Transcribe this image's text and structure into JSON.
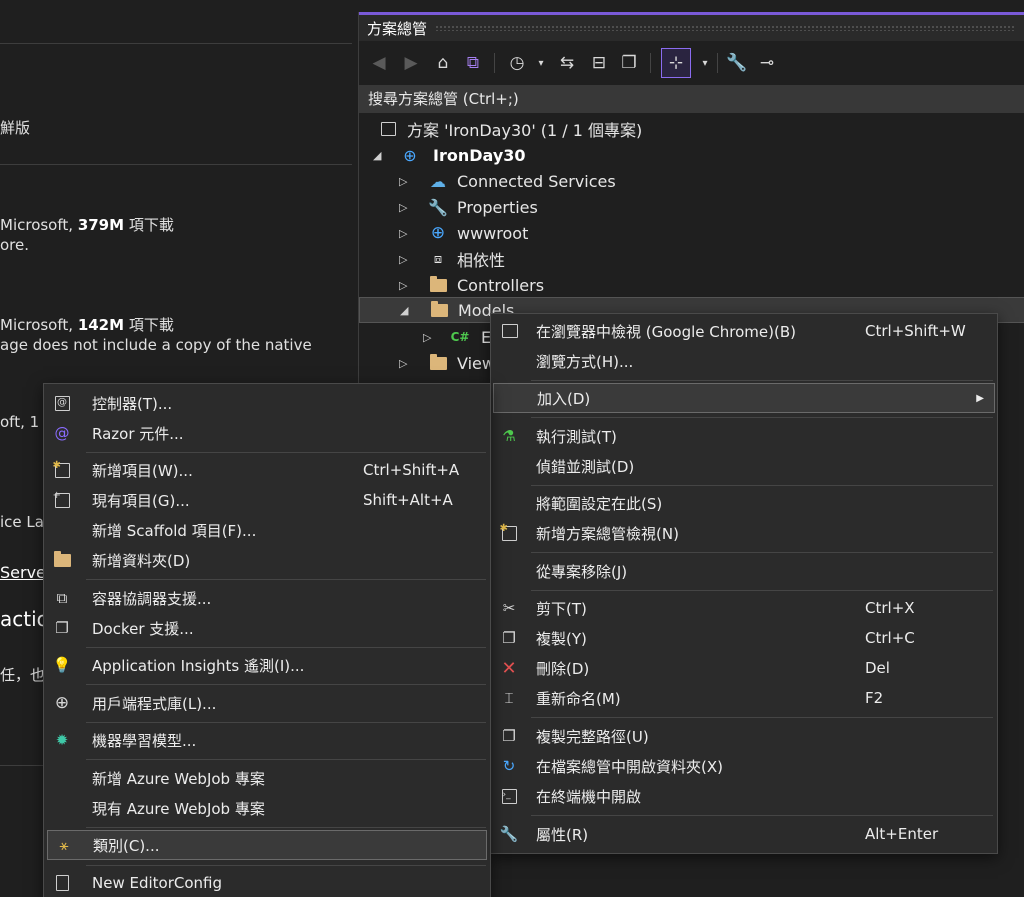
{
  "left_panel": {
    "line1": "鮮版",
    "pkg1_author_prefix": "Microsoft, ",
    "pkg1_downloads": "379M",
    "pkg1_downloads_suffix": " 項下載",
    "pkg1_desc": "ore.",
    "pkg2_author_prefix": "Microsoft, ",
    "pkg2_downloads": "142M",
    "pkg2_downloads_suffix": " 項下載",
    "pkg2_desc": "age does not include a copy of the native",
    "pkg3_author": "oft, 1",
    "frag_ice": "ice La",
    "frag_serve": "Serve",
    "frag_actio": "actio",
    "frag_chinese": "任，也"
  },
  "solution_explorer": {
    "title": "方案總管",
    "search_placeholder": "搜尋方案總管 (Ctrl+;)",
    "tree": {
      "solution": "方案 'IronDay30' (1 / 1 個專案)",
      "project": "IronDay30",
      "connected_services": "Connected Services",
      "properties": "Properties",
      "wwwroot": "wwwroot",
      "dependencies": "相依性",
      "controllers": "Controllers",
      "models": "Models",
      "model_file": "E",
      "views": "View"
    }
  },
  "context_menu": {
    "items": [
      {
        "label": "在瀏覽器中檢視 (Google Chrome)(B)",
        "shortcut": "Ctrl+Shift+W",
        "icon": "browser-icon"
      },
      {
        "label": "瀏覽方式(H)...",
        "shortcut": "",
        "icon": ""
      },
      {
        "label": "加入(D)",
        "shortcut": "",
        "icon": ""
      },
      {
        "label": "執行測試(T)",
        "shortcut": "",
        "icon": "run-tests-icon"
      },
      {
        "label": "偵錯並測試(D)",
        "shortcut": "",
        "icon": ""
      },
      {
        "label": "將範圍設定在此(S)",
        "shortcut": "",
        "icon": ""
      },
      {
        "label": "新增方案總管檢視(N)",
        "shortcut": "",
        "icon": "new-view-icon"
      },
      {
        "label": "從專案移除(J)",
        "shortcut": "",
        "icon": ""
      },
      {
        "label": "剪下(T)",
        "shortcut": "Ctrl+X",
        "icon": "cut-icon"
      },
      {
        "label": "複製(Y)",
        "shortcut": "Ctrl+C",
        "icon": "copy-icon"
      },
      {
        "label": "刪除(D)",
        "shortcut": "Del",
        "icon": "delete-icon"
      },
      {
        "label": "重新命名(M)",
        "shortcut": "F2",
        "icon": "rename-icon"
      },
      {
        "label": "複製完整路徑(U)",
        "shortcut": "",
        "icon": "copy-path-icon"
      },
      {
        "label": "在檔案總管中開啟資料夾(X)",
        "shortcut": "",
        "icon": "open-folder-icon"
      },
      {
        "label": "在終端機中開啟",
        "shortcut": "",
        "icon": "terminal-icon"
      },
      {
        "label": "屬性(R)",
        "shortcut": "Alt+Enter",
        "icon": "wrench-icon"
      }
    ]
  },
  "add_submenu": {
    "items": [
      {
        "label": "控制器(T)...",
        "shortcut": "",
        "icon": "controller-icon"
      },
      {
        "label": "Razor 元件...",
        "shortcut": "",
        "icon": "razor-icon"
      },
      {
        "label": "新增項目(W)...",
        "shortcut": "Ctrl+Shift+A",
        "icon": "new-item-icon"
      },
      {
        "label": "現有項目(G)...",
        "shortcut": "Shift+Alt+A",
        "icon": "existing-item-icon"
      },
      {
        "label": "新增 Scaffold 項目(F)...",
        "shortcut": "",
        "icon": ""
      },
      {
        "label": "新增資料夾(D)",
        "shortcut": "",
        "icon": "new-folder-icon"
      },
      {
        "label": "容器協調器支援...",
        "shortcut": "",
        "icon": "orchestrator-icon"
      },
      {
        "label": "Docker 支援...",
        "shortcut": "",
        "icon": "docker-icon"
      },
      {
        "label": "Application Insights 遙測(I)...",
        "shortcut": "",
        "icon": "insights-icon"
      },
      {
        "label": "用戶端程式庫(L)...",
        "shortcut": "",
        "icon": "client-library-icon"
      },
      {
        "label": "機器學習模型...",
        "shortcut": "",
        "icon": "ml-model-icon"
      },
      {
        "label": "新增 Azure WebJob 專案",
        "shortcut": "",
        "icon": ""
      },
      {
        "label": "現有 Azure WebJob 專案",
        "shortcut": "",
        "icon": ""
      },
      {
        "label": "類別(C)...",
        "shortcut": "",
        "icon": "class-icon"
      },
      {
        "label": "New EditorConfig",
        "shortcut": "",
        "icon": "editorconfig-icon"
      }
    ]
  },
  "colors": {
    "accent": "#7a5ad8",
    "background": "#1f1f1f",
    "menu_bg": "#2b2b2b"
  }
}
